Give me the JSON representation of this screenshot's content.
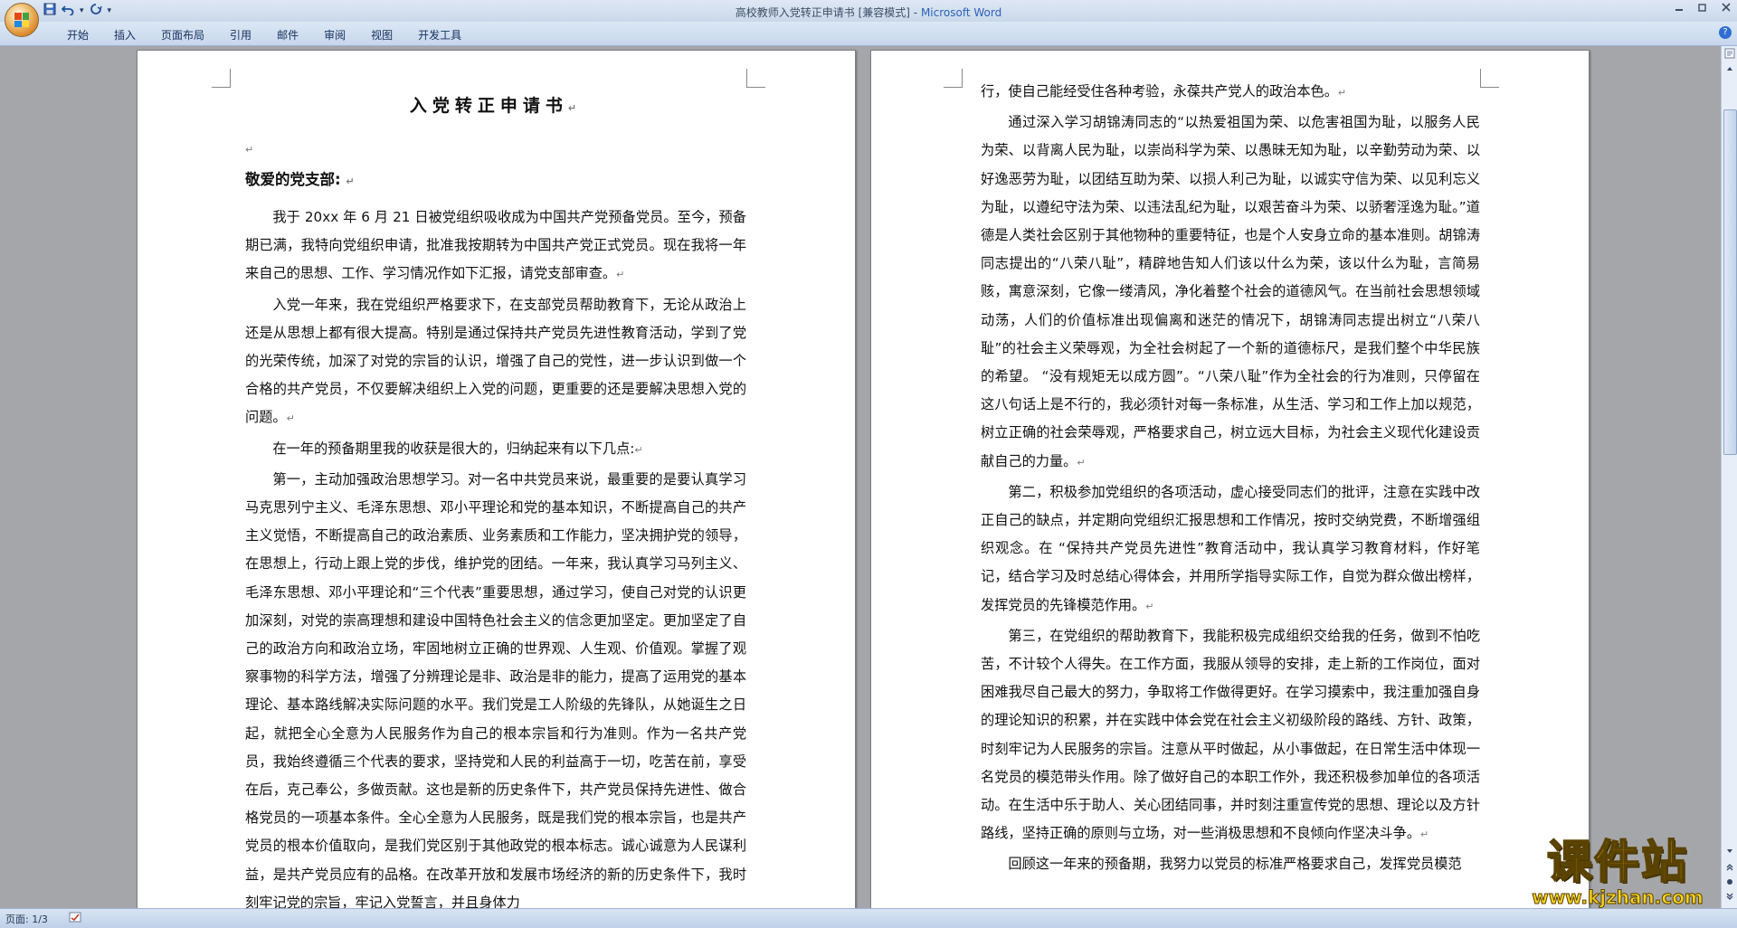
{
  "window": {
    "title": "高校教师入党转正申请书 [兼容模式]",
    "app_name": "Microsoft Word",
    "separator": " - "
  },
  "quick_access": {
    "save_icon": "save-icon",
    "undo_icon": "undo-icon",
    "redo_icon": "redo-icon",
    "customize_glyph": "▾"
  },
  "ribbon_tabs": [
    "开始",
    "插入",
    "页面布局",
    "引用",
    "邮件",
    "审阅",
    "视图",
    "开发工具"
  ],
  "status": {
    "page": "页面: 1/3"
  },
  "watermark": {
    "brand": "课件站",
    "url": "www.kjzhan.com"
  },
  "colors": {
    "title_accent": "#2a62b8",
    "watermark_fill": "#f6d31e"
  },
  "document": {
    "page1": {
      "title": "入党转正申请书",
      "salutation": "敬爱的党支部:",
      "paragraphs": [
        "我于 20xx 年 6 月 21 日被党组织吸收成为中国共产党预备党员。至今，预备期已满，我特向党组织申请，批准我按期转为中国共产党正式党员。现在我将一年来自己的思想、工作、学习情况作如下汇报，请党支部审查。",
        "入党一年来，我在党组织严格要求下，在支部党员帮助教育下，无论从政治上还是从思想上都有很大提高。特别是通过保持共产党员先进性教育活动，学到了党的光荣传统，加深了对党的宗旨的认识，增强了自己的党性，进一步认识到做一个合格的共产党员，不仅要解决组织上入党的问题，更重要的还是要解决思想入党的问题。",
        "在一年的预备期里我的收获是很大的，归纳起来有以下几点:",
        "第一，主动加强政治思想学习。对一名中共党员来说，最重要的是要认真学习马克思列宁主义、毛泽东思想、邓小平理论和党的基本知识，不断提高自己的共产主义觉悟，不断提高自己的政治素质、业务素质和工作能力，坚决拥护党的领导，在思想上，行动上跟上党的步伐，维护党的团结。一年来，我认真学习马列主义、毛泽东思想、邓小平理论和“三个代表”重要思想，通过学习，使自己对党的认识更加深刻，对党的崇高理想和建设中国特色社会主义的信念更加坚定。更加坚定了自己的政治方向和政治立场，牢固地树立正确的世界观、人生观、价值观。掌握了观察事物的科学方法，增强了分辨理论是非、政治是非的能力，提高了运用党的基本理论、基本路线解决实际问题的水平。我们党是工人阶级的先锋队，从她诞生之日起，就把全心全意为人民服务作为自己的根本宗旨和行为准则。作为一名共产党员，我始终遵循三个代表的要求，坚持党和人民的利益高于一切，吃苦在前，享受在后，克己奉公，多做贡献。这也是新的历史条件下，共产党员保持先进性、做合格党员的一项基本条件。全心全意为人民服务，既是我们党的根本宗旨，也是共产党员的根本价值取向，是我们党区别于其他政党的根本标志。诚心诚意为人民谋利益，是共产党员应有的品格。在改革开放和发展市场经济的新的历史条件下，我时刻牢记党的宗旨，牢记入党誓言，并且身体力"
      ]
    },
    "page2": {
      "paragraphs": [
        "行，使自己能经受住各种考验，永葆共产党人的政治本色。",
        "通过深入学习胡锦涛同志的“以热爱祖国为荣、以危害祖国为耻，以服务人民为荣、以背离人民为耻，以崇尚科学为荣、以愚昧无知为耻，以辛勤劳动为荣、以好逸恶劳为耻，以团结互助为荣、以损人利己为耻，以诚实守信为荣、以见利忘义为耻，以遵纪守法为荣、以违法乱纪为耻，以艰苦奋斗为荣、以骄奢淫逸为耻。”道德是人类社会区别于其他物种的重要特征，也是个人安身立命的基本准则。胡锦涛同志提出的“八荣八耻”，精辟地告知人们该以什么为荣，该以什么为耻，言简易赅，寓意深刻，它像一缕清风，净化着整个社会的道德风气。在当前社会思想领域动荡，人们的价值标准出现偏离和迷茫的情况下，胡锦涛同志提出树立“八荣八耻”的社会主义荣辱观，为全社会树起了一个新的道德标尺，是我们整个中华民族的希望。 “没有规矩无以成方圆”。“八荣八耻”作为全社会的行为准则，只停留在这八句话上是不行的，我必须针对每一条标准，从生活、学习和工作上加以规范，树立正确的社会荣辱观，严格要求自己，树立远大目标，为社会主义现代化建设贡献自己的力量。",
        "第二，积极参加党组织的各项活动，虚心接受同志们的批评，注意在实践中改正自己的缺点，并定期向党组织汇报思想和工作情况，按时交纳党费，不断增强组织观念。在 “保持共产党员先进性”教育活动中，我认真学习教育材料，作好笔记，结合学习及时总结心得体会，并用所学指导实际工作，自觉为群众做出榜样，发挥党员的先锋模范作用。",
        "第三，在党组织的帮助教育下，我能积极完成组织交给我的任务，做到不怕吃苦，不计较个人得失。在工作方面，我服从领导的安排，走上新的工作岗位，面对困难我尽自己最大的努力，争取将工作做得更好。在学习摸索中，我注重加强自身的理论知识的积累，并在实践中体会党在社会主义初级阶段的路线、方针、政策，时刻牢记为人民服务的宗旨。注意从平时做起，从小事做起，在日常生活中体现一名党员的模范带头作用。除了做好自己的本职工作外，我还积极参加单位的各项活动。在生活中乐于助人、关心团结同事，并时刻注重宣传党的思想、理论以及方针路线，坚持正确的原则与立场，对一些消极思想和不良倾向作坚决斗争。",
        "回顾这一年来的预备期，我努力以党员的标准严格要求自己，发挥党员模范"
      ]
    }
  }
}
